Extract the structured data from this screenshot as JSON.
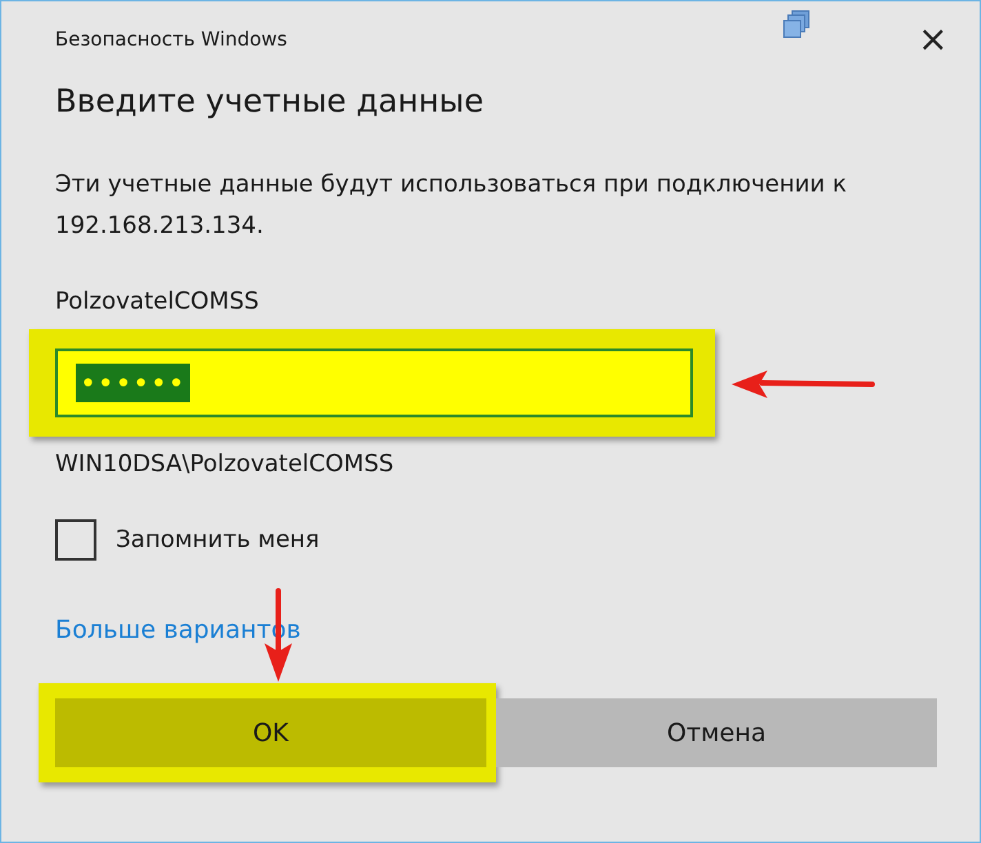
{
  "window": {
    "title": "Безопасность Windows",
    "close": "×"
  },
  "heading": "Введите учетные данные",
  "message": "Эти учетные данные будут использоваться при подключении к 192.168.213.134.",
  "username": "PolzovatelCOMSS",
  "password": {
    "value": "••••••",
    "selected": true,
    "highlighted": true
  },
  "domain_user": "WIN10DSA\\PolzovatelCOMSS",
  "remember": {
    "label": "Запомнить меня",
    "checked": false
  },
  "more_link": "Больше вариантов",
  "buttons": [
    {
      "label": "OK",
      "highlighted": true
    },
    {
      "label": "Отмена",
      "highlighted": false
    }
  ]
}
